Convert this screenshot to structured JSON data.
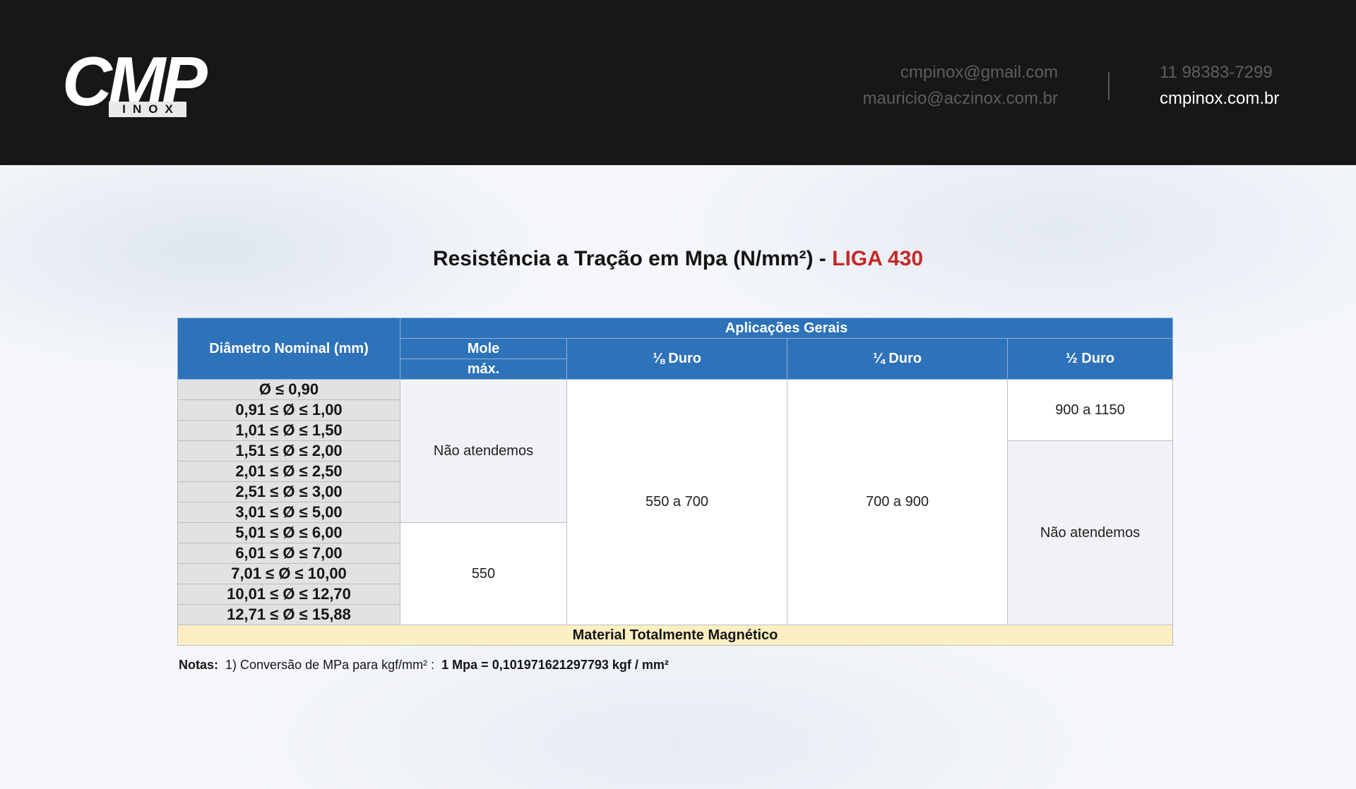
{
  "header": {
    "logo_text": "CMP",
    "logo_sub": "INOX",
    "emails": [
      "cmpinox@gmail.com",
      "mauricio@aczinox.com.br"
    ],
    "phone": "11 98383-7299",
    "website": "cmpinox.com.br"
  },
  "title": {
    "main": "Resistência a Tração em Mpa (N/mm²) - ",
    "accent": "LIGA 430",
    "accent_color": "#c62828"
  },
  "table": {
    "col_diameter": "Diâmetro Nominal (mm)",
    "group_header": "Aplicações Gerais",
    "col_mole": "Mole",
    "col_mole_sub": "máx.",
    "col_eighth": "⅛ Duro",
    "col_quarter": "¼ Duro",
    "col_half": "½ Duro",
    "rows": [
      "Ø ≤ 0,90",
      "0,91 ≤  Ø  ≤ 1,00",
      "1,01 ≤  Ø  ≤ 1,50",
      "1,51 ≤  Ø  ≤ 2,00",
      "2,01 ≤  Ø  ≤ 2,50",
      "2,51 ≤  Ø  ≤ 3,00",
      "3,01 ≤ Ø  ≤ 5,00",
      "5,01 ≤  Ø  ≤ 6,00",
      "6,01 ≤  Ø  ≤ 7,00",
      "7,01 ≤  Ø  ≤ 10,00",
      "10,01 ≤  Ø  ≤ 12,70",
      "12,71 ≤  Ø  ≤ 15,88"
    ],
    "mole_upper": "Não atendemos",
    "mole_lower": "550",
    "eighth_value": "550 a 700",
    "quarter_value": "700 a 900",
    "half_upper": "900 a 1150",
    "half_lower": "Não atendemos",
    "footer": "Material Totalmente Magnético",
    "header_color": "#2e72ba",
    "footer_color": "#fdefc2"
  },
  "notes": {
    "label": "Notas:",
    "text": "1) Conversão de MPa para kgf/mm² :",
    "formula": "1 Mpa = 0,101971621297793 kgf / mm²"
  }
}
